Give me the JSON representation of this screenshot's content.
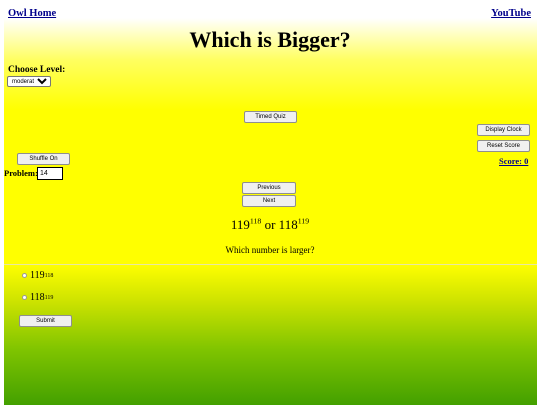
{
  "nav": {
    "home_link": "Owl Home",
    "youtube_link": "YouTube"
  },
  "title": "Which is Bigger?",
  "level": {
    "label": "Choose Level:",
    "selected": "moderate"
  },
  "buttons": {
    "timed_quiz": "Timed Quiz",
    "display_clock": "Display Clock",
    "reset_score": "Reset Score",
    "shuffle": "Shuffle On",
    "previous": "Previous",
    "next": "Next",
    "submit": "Submit"
  },
  "score": {
    "label": "Score: 0"
  },
  "problem": {
    "label": "Problem:",
    "value": "14"
  },
  "question": {
    "a_base": "119",
    "a_exp": "118",
    "connector": " or ",
    "b_base": "118",
    "b_exp": "119",
    "prompt": "Which number is larger?"
  },
  "options": [
    {
      "base": "119",
      "exp": "118"
    },
    {
      "base": "118",
      "exp": "119"
    }
  ]
}
